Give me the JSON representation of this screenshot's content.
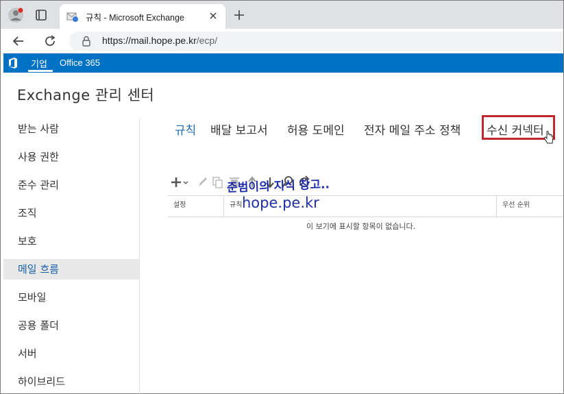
{
  "browser": {
    "tab_title": "규칙 - Microsoft Exchange",
    "url_host": "https://mail.hope.pe.kr",
    "url_path": "/ecp/"
  },
  "office_bar": {
    "items": [
      "기업",
      "Office 365"
    ]
  },
  "app_title": "Exchange 관리 센터",
  "left_nav": {
    "items": [
      {
        "label": "받는 사람"
      },
      {
        "label": "사용 권한"
      },
      {
        "label": "준수 관리"
      },
      {
        "label": "조직"
      },
      {
        "label": "보호"
      },
      {
        "label": "메일 흐름",
        "selected": true
      },
      {
        "label": "모바일"
      },
      {
        "label": "공용 폴더"
      },
      {
        "label": "서버"
      },
      {
        "label": "하이브리드"
      }
    ]
  },
  "sub_tabs": [
    {
      "label": "규칙",
      "active": true
    },
    {
      "label": "배달 보고서"
    },
    {
      "label": "허용 도메인"
    },
    {
      "label": "전자 메일 주소 정책"
    },
    {
      "label": "수신 커넥터",
      "highlighted": true
    }
  ],
  "grid": {
    "columns": [
      "설정",
      "규칙",
      "우선 순위"
    ],
    "empty_message": "이 보기에 표시할 항목이 없습니다."
  },
  "watermark": {
    "line1": "준범이의 지식 창고..",
    "line2": "hope.pe.kr"
  },
  "colors": {
    "o365_blue": "#0072c6",
    "highlight_red": "#c0272d",
    "active_blue": "#1f6cb1"
  }
}
